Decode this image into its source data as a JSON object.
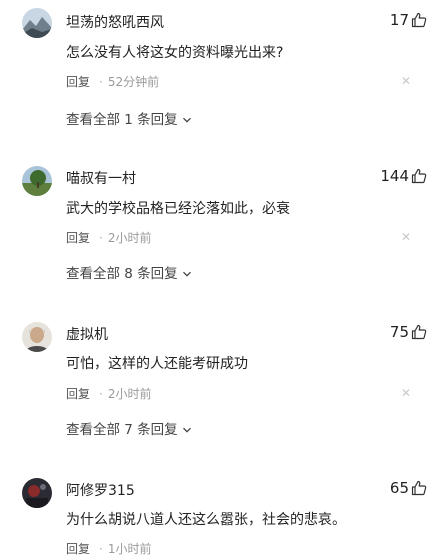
{
  "comments": [
    {
      "username": "坦荡的怒吼西风",
      "likes": "17",
      "content": "怎么没有人将这女的资料曝光出来?",
      "reply_label": "回复",
      "time": "52分钟前",
      "view_all_label": "查看全部 1 条回复",
      "avatar": "mountain-landscape-avatar"
    },
    {
      "username": "喵叔有一村",
      "likes": "144",
      "content": "武大的学校品格已经沦落如此，必衰",
      "reply_label": "回复",
      "time": "2小时前",
      "view_all_label": "查看全部 8 条回复",
      "avatar": "tree-landscape-avatar"
    },
    {
      "username": "虚拟机",
      "likes": "75",
      "content": "可怕，这样的人还能考研成功",
      "reply_label": "回复",
      "time": "2小时前",
      "view_all_label": "查看全部 7 条回复",
      "avatar": "person-photo-avatar"
    },
    {
      "username": "阿修罗315",
      "likes": "65",
      "content": "为什么胡说八道人还这么嚣张，社会的悲哀。",
      "reply_label": "回复",
      "time": "1小时前",
      "avatar": "dark-scene-avatar"
    }
  ]
}
